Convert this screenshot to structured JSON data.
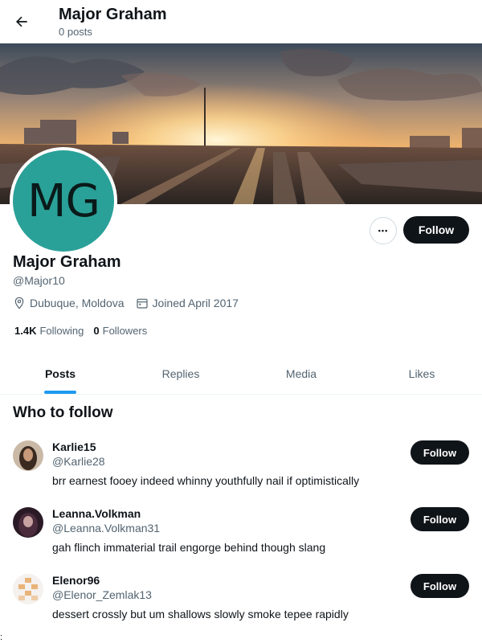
{
  "header": {
    "title": "Major Graham",
    "post_count": "0 posts",
    "back_icon": "arrow-left-icon"
  },
  "profile": {
    "avatar_initials": "MG",
    "avatar_color": "#2aa198",
    "name": "Major Graham",
    "handle": "@Major10",
    "location": "Dubuque, Moldova",
    "joined": "Joined April 2017",
    "following_count": "1.4K",
    "following_label": "Following",
    "followers_count": "0",
    "followers_label": "Followers",
    "more_label": "•••",
    "follow_label": "Follow"
  },
  "tabs": [
    {
      "label": "Posts",
      "active": true
    },
    {
      "label": "Replies",
      "active": false
    },
    {
      "label": "Media",
      "active": false
    },
    {
      "label": "Likes",
      "active": false
    }
  ],
  "who_to_follow": {
    "title": "Who to follow",
    "users": [
      {
        "name": "Karlie15",
        "handle": "@Karlie28",
        "bio": "brr earnest fooey indeed whinny youthfully nail if optimistically",
        "follow_label": "Follow"
      },
      {
        "name": "Leanna.Volkman",
        "handle": "@Leanna.Volkman31",
        "bio": "gah flinch immaterial trail engorge behind though slang",
        "follow_label": "Follow"
      },
      {
        "name": "Elenor96",
        "handle": "@Elenor_Zemlak13",
        "bio": "dessert crossly but um shallows slowly smoke tepee rapidly",
        "follow_label": "Follow"
      }
    ]
  },
  "colors": {
    "accent": "#1d9bf0",
    "button_dark": "#0f1419",
    "muted_text": "#536471"
  },
  "edge_mark": ":"
}
